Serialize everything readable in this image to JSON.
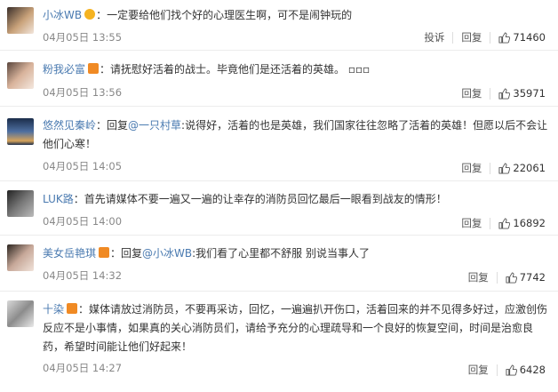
{
  "comments": [
    {
      "user": "小冰WB",
      "text": "：一定要给他们找个好的心理医生啊，可不是闹钟玩的",
      "mention": "",
      "time": "04月05日 13:55",
      "report": "投诉",
      "reply": "回复",
      "likes": "71460",
      "badge": "gold"
    },
    {
      "user": "粉我必富",
      "text": "：请抚慰好活着的战士。毕竟他们是还活着的英雄。 ▫▫▫",
      "mention": "",
      "time": "04月05日 13:56",
      "report": "",
      "reply": "回复",
      "likes": "35971",
      "badge": "orange"
    },
    {
      "user": "悠然见秦岭",
      "reply_prefix": "：回复",
      "mention": "@一只村草",
      "text": ":说得好，活着的也是英雄，我们国家往往忽略了活着的英雄！但愿以后不会让他们心寒！",
      "time": "04月05日 14:05",
      "report": "",
      "reply": "回复",
      "likes": "22061",
      "badge": ""
    },
    {
      "user": "LUK路",
      "text": "：首先请媒体不要一遍又一遍的让幸存的消防员回忆最后一眼看到战友的情形！",
      "mention": "",
      "time": "04月05日 14:00",
      "report": "",
      "reply": "回复",
      "likes": "16892",
      "badge": ""
    },
    {
      "user": "美女岳艳琪",
      "reply_prefix": "：回复",
      "mention": "@小冰WB",
      "text": ":我们看了心里都不舒服 别说当事人了",
      "time": "04月05日 14:32",
      "report": "",
      "reply": "回复",
      "likes": "7742",
      "badge": "orange"
    },
    {
      "user": "十染",
      "text": "：媒体请放过消防员，不要再采访，回忆，一遍遍扒开伤口，活着回来的并不见得多好过，应激创伤反应不是小事情，如果真的关心消防员们，请给予充分的心理疏导和一个良好的恢复空间，时间是治愈良药，希望时间能让他们好起来！",
      "mention": "",
      "time": "04月05日 14:27",
      "report": "",
      "reply": "回复",
      "likes": "6428",
      "badge": "orange"
    }
  ]
}
